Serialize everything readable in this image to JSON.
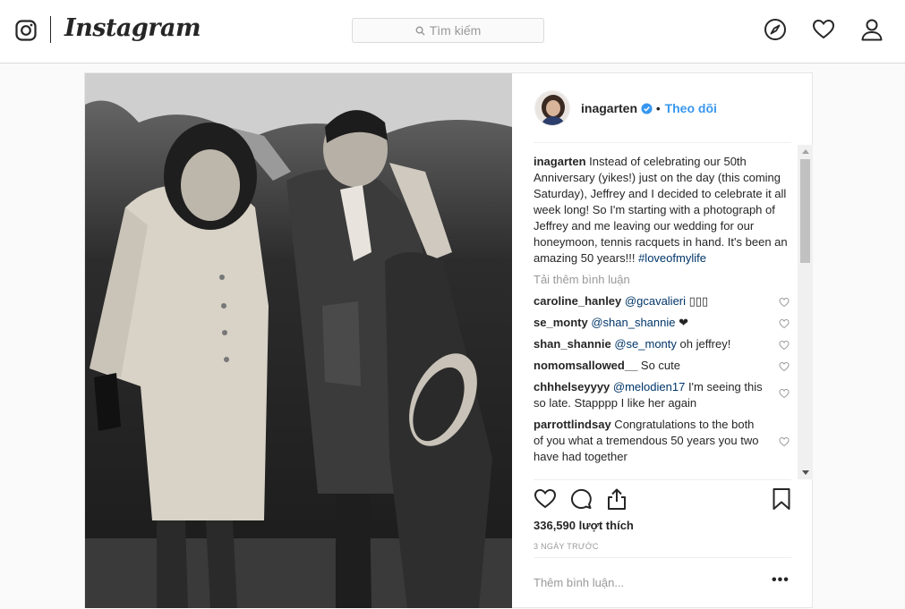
{
  "header": {
    "brand": "Instagram",
    "search_placeholder": "Tìm kiếm",
    "icons": [
      "instagram-glyph-icon",
      "search-icon",
      "compass-icon",
      "heart-icon",
      "user-icon"
    ]
  },
  "post": {
    "username": "inagarten",
    "follow_label": "Theo dõi",
    "separator": "•",
    "caption_user": "inagarten",
    "caption_text": "Instead of celebrating our 50th Anniversary (yikes!) just on the day (this coming Saturday), Jeffrey and I decided to celebrate it all week long! So I'm starting with a photograph of Jeffrey and me leaving our wedding for our honeymoon, tennis racquets in hand. It's been an amazing 50 years!!!",
    "caption_hashtag": "#loveofmylife",
    "load_more": "Tải thêm bình luận",
    "comments": [
      {
        "user": "caroline_hanley",
        "mention": "@gcavalieri",
        "text": " ▯▯▯"
      },
      {
        "user": "se_monty",
        "mention": "@shan_shannie",
        "text": " ❤"
      },
      {
        "user": "shan_shannie",
        "mention": "@se_monty",
        "text": " oh jeffrey!"
      },
      {
        "user": "nomomsallowed__",
        "mention": "",
        "text": " So cute"
      },
      {
        "user": "chhhelseyyyy",
        "mention": "@melodien17",
        "text": " I'm seeing this so late. Stapppp I like her again"
      },
      {
        "user": "parrottlindsay",
        "mention": "",
        "text": " Congratulations to the both of you what a tremendous 50 years you two have had together"
      }
    ],
    "likes": "336,590 lượt thích",
    "time": "3 NGÀY TRƯỚC",
    "add_comment_placeholder": "Thêm bình luận...",
    "more_label": "•••"
  },
  "colors": {
    "accent": "#3897f0",
    "link": "#003569",
    "border": "#dbdbdb",
    "muted": "#999999"
  }
}
